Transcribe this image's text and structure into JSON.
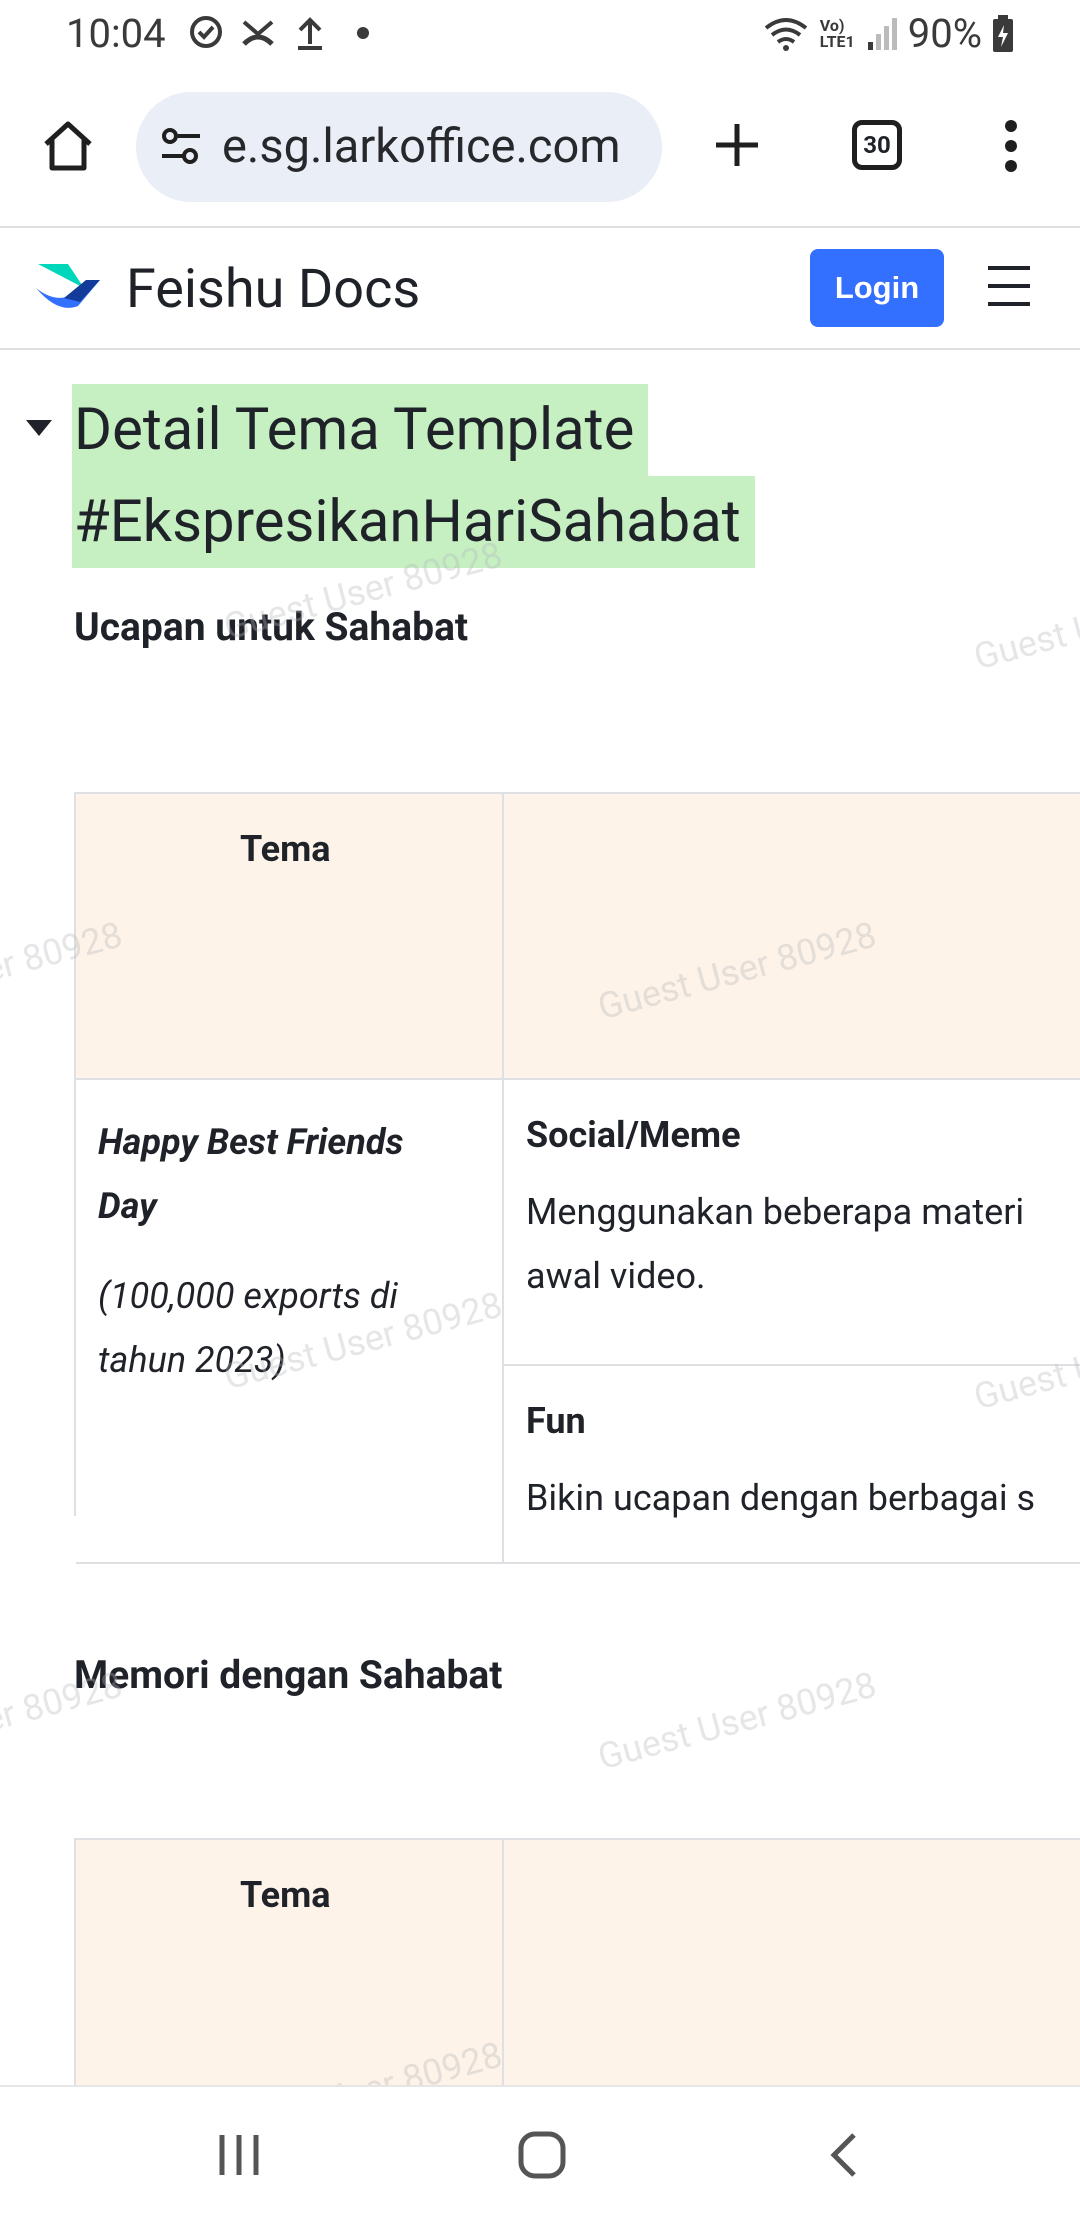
{
  "status_bar": {
    "time": "10:04",
    "network": "Vo) LTE1",
    "battery": "90%"
  },
  "browser": {
    "url": "e.sg.larkoffice.com",
    "tab_count": "30"
  },
  "header": {
    "brand": "Feishu Docs",
    "login_label": "Login"
  },
  "document": {
    "heading_line1": "Detail Tema Template",
    "heading_line2": "#EkspresikanHariSahabat",
    "section1_title": "Ucapan untuk Sahabat",
    "section2_title": "Memori dengan Sahabat",
    "table1": {
      "header_col1": "Tema",
      "header_col2": "",
      "row_theme_title": "Happy Best Friends",
      "row_theme_title2": "Day",
      "row_theme_note1": "(100,000 exports di",
      "row_theme_note2": "tahun 2023)",
      "sub1_title": "Social/Meme",
      "sub1_line1": "Menggunakan beberapa materi",
      "sub1_line2": "awal video.",
      "sub2_title": "Fun",
      "sub2_line1": "Bikin ucapan dengan berbagai s"
    },
    "table2": {
      "header_col1": "Tema",
      "header_col2": ""
    }
  },
  "watermark": "Guest User 80928",
  "colors": {
    "accent": "#3370ff",
    "heading_highlight": "#c6f0c2",
    "table_header_bg": "#fef3e8"
  }
}
